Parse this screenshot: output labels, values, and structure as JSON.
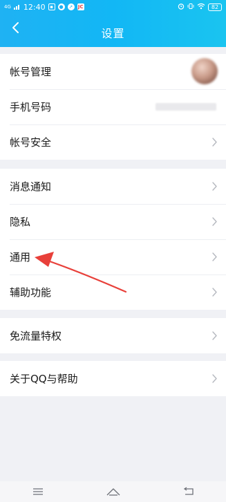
{
  "status_bar": {
    "network": "4G",
    "time": "12:40",
    "battery": "82"
  },
  "header": {
    "title": "设置"
  },
  "groups": [
    {
      "items": [
        {
          "label": "帐号管理",
          "trailing": "avatar"
        },
        {
          "label": "手机号码",
          "trailing": "masked-phone"
        },
        {
          "label": "帐号安全",
          "trailing": "chevron"
        }
      ]
    },
    {
      "items": [
        {
          "label": "消息通知",
          "trailing": "chevron"
        },
        {
          "label": "隐私",
          "trailing": "chevron"
        },
        {
          "label": "通用",
          "trailing": "chevron"
        },
        {
          "label": "辅助功能",
          "trailing": "chevron"
        }
      ]
    },
    {
      "items": [
        {
          "label": "免流量特权",
          "trailing": "chevron"
        }
      ]
    },
    {
      "items": [
        {
          "label": "关于QQ与帮助",
          "trailing": "chevron"
        }
      ]
    }
  ],
  "colors": {
    "header_bg": "#12b7f5",
    "page_bg": "#f0f1f5",
    "annotation_arrow": "#e8403a"
  },
  "icons": {
    "back": "chevron-left-icon",
    "row": "chevron-right-icon",
    "nav": [
      "menu-icon",
      "home-icon",
      "back-icon"
    ]
  }
}
